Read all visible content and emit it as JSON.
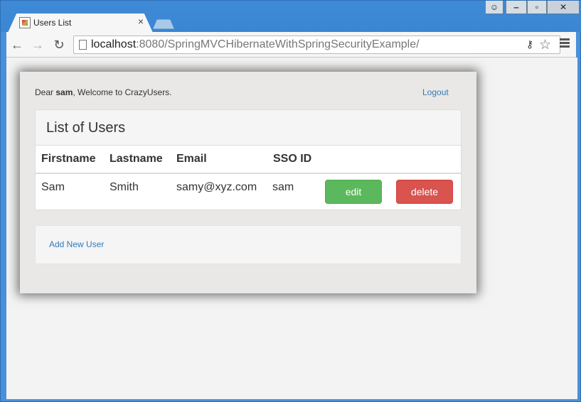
{
  "browser": {
    "tab_title": "Users List",
    "tab_close": "×",
    "url_host": "localhost",
    "url_rest": ":8080/SpringMVCHibernateWithSpringSecurityExample/",
    "back": "←",
    "forward": "→",
    "reload": "↻",
    "key_glyph": "⚷",
    "star_glyph": "☆",
    "win_min": "‒",
    "win_max": "▫",
    "win_close": "✕",
    "win_user": "☺"
  },
  "header": {
    "welcome_prefix": "Dear ",
    "username": "sam",
    "welcome_suffix": ", Welcome to CrazyUsers.",
    "logout_label": "Logout"
  },
  "users_panel": {
    "title": "List of Users",
    "columns": [
      "Firstname",
      "Lastname",
      "Email",
      "SSO ID"
    ],
    "rows": [
      {
        "firstname": "Sam",
        "lastname": "Smith",
        "email": "samy@xyz.com",
        "sso_id": "sam",
        "edit_label": "edit",
        "delete_label": "delete"
      }
    ]
  },
  "footer": {
    "add_user_label": "Add New User"
  },
  "colors": {
    "edit": "#5cb85c",
    "delete": "#d9534f",
    "link": "#337ab7"
  }
}
